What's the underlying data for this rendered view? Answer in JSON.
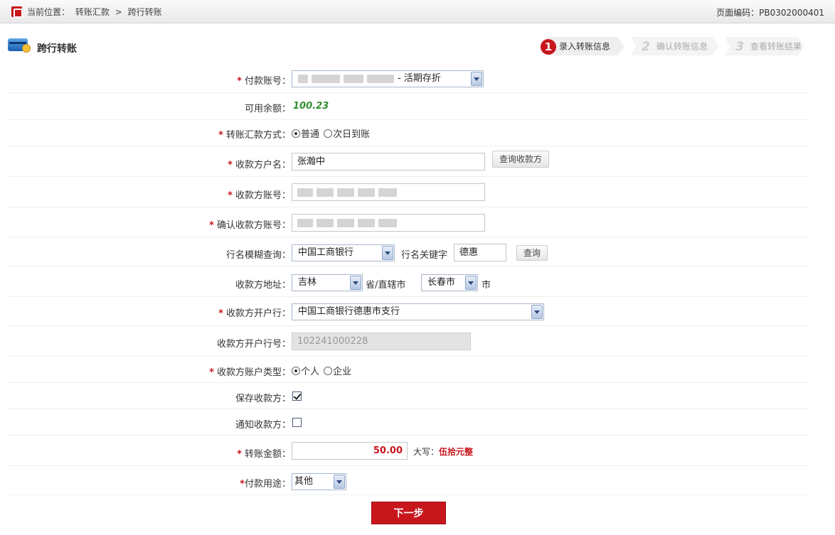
{
  "header": {
    "breadcrumb_prefix": "当前位置：",
    "breadcrumb_parent": "转账汇款",
    "breadcrumb_sep": ">",
    "breadcrumb_current": "跨行转账",
    "page_code": "页面编码：PB0302000401"
  },
  "page": {
    "title": "跨行转账"
  },
  "steps": [
    {
      "num": "1",
      "label": "录入转账信息",
      "state": "active"
    },
    {
      "num": "2",
      "label": "确认转账信息",
      "state": "inactive"
    },
    {
      "num": "3",
      "label": "查看转账结果",
      "state": "inactive"
    }
  ],
  "form": {
    "required_mark": "*",
    "payer_account": {
      "label": "付款账号：",
      "suffix": "- 活期存折"
    },
    "balance": {
      "label": "可用余额：",
      "value": "100.23"
    },
    "transfer_mode": {
      "label": "转账汇款方式：",
      "options": [
        "普通",
        "次日到账"
      ],
      "selected": "普通"
    },
    "payee_name": {
      "label": "收款方户名：",
      "value": "张瀚中",
      "lookup_button": "查询收款方"
    },
    "payee_account": {
      "label": "收款方账号："
    },
    "confirm_account": {
      "label": "确认收款方账号："
    },
    "bank_search": {
      "label": "行名模糊查询：",
      "bank": "中国工商银行",
      "keyword_label": "行名关键字",
      "keyword": "德惠",
      "search_button": "查询"
    },
    "address": {
      "label": "收款方地址：",
      "province": "吉林",
      "province_suffix": "省/直辖市",
      "city": "长春市",
      "city_suffix": "市"
    },
    "branch": {
      "label": "收款方开户行：",
      "value": "中国工商银行德惠市支行"
    },
    "branch_code": {
      "label": "收款方开户行号：",
      "value": "102241000228"
    },
    "account_type": {
      "label": "收款方账户类型：",
      "options": [
        "个人",
        "企业"
      ],
      "selected": "个人"
    },
    "save_payee": {
      "label": "保存收款方：",
      "checked": true
    },
    "notify_payee": {
      "label": "通知收款方：",
      "checked": false
    },
    "amount": {
      "label": "转账金额：",
      "value": "50.00",
      "caps_label": "大写：",
      "caps_value": "伍拾元整"
    },
    "purpose": {
      "label": "付款用途：",
      "value": "其他"
    }
  },
  "actions": {
    "next": "下一步"
  },
  "colors": {
    "accent": "#c8161d",
    "balance": "#2f8f2f"
  }
}
